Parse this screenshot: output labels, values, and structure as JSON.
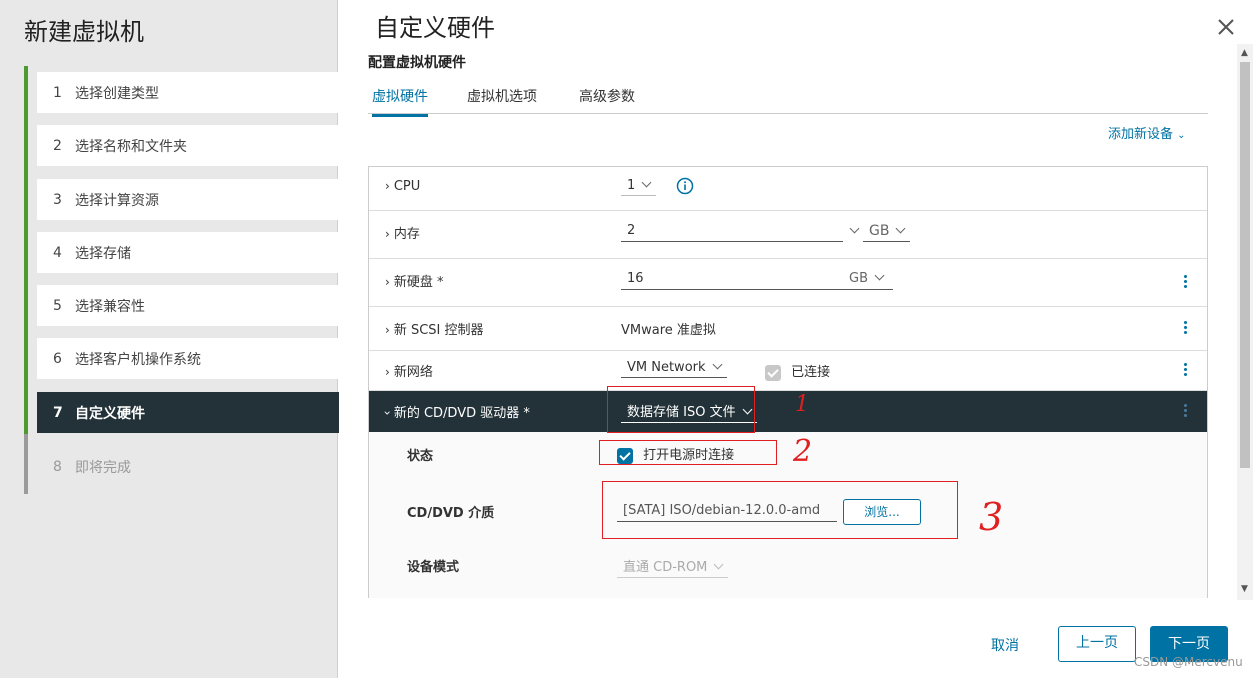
{
  "wizard": {
    "title": "新建虚拟机",
    "steps": [
      {
        "num": "1",
        "label": "选择创建类型"
      },
      {
        "num": "2",
        "label": "选择名称和文件夹"
      },
      {
        "num": "3",
        "label": "选择计算资源"
      },
      {
        "num": "4",
        "label": "选择存储"
      },
      {
        "num": "5",
        "label": "选择兼容性"
      },
      {
        "num": "6",
        "label": "选择客户机操作系统"
      },
      {
        "num": "7",
        "label": "自定义硬件"
      },
      {
        "num": "8",
        "label": "即将完成"
      }
    ]
  },
  "page": {
    "title": "自定义硬件",
    "subtitle": "配置虚拟机硬件",
    "tabs": [
      "虚拟硬件",
      "虚拟机选项",
      "高级参数"
    ],
    "add_device": "添加新设备"
  },
  "hardware": {
    "cpu": {
      "label": "CPU",
      "value": "1"
    },
    "memory": {
      "label": "内存",
      "value": "2",
      "unit": "GB"
    },
    "disk": {
      "label": "新硬盘 *",
      "value": "16",
      "unit": "GB"
    },
    "scsi": {
      "label": "新 SCSI 控制器",
      "value": "VMware 准虚拟"
    },
    "network": {
      "label": "新网络",
      "value": "VM Network",
      "connected_label": "已连接"
    },
    "cddvd": {
      "label": "新的 CD/DVD 驱动器 *",
      "value": "数据存储 ISO 文件",
      "status_label": "状态",
      "status_value": "打开电源时连接",
      "media_label": "CD/DVD 介质",
      "media_value": "[SATA] ISO/debian-12.0.0-amd",
      "browse_label": "浏览...",
      "device_mode_label": "设备模式",
      "device_mode_value": "直通 CD-ROM"
    }
  },
  "footer": {
    "cancel": "取消",
    "prev": "上一页",
    "next": "下一页"
  },
  "annotations": {
    "mark1": "1",
    "mark2": "2",
    "mark3": "3"
  },
  "watermark": "CSDN @Mercvenu",
  "colors": {
    "accent": "#0072a3",
    "dark_row": "#223238",
    "progress_green": "#4b9b32",
    "annotation_red": "#e02020"
  }
}
